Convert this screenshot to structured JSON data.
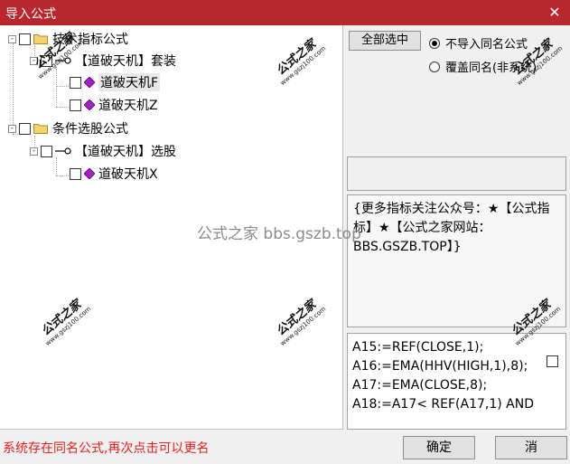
{
  "window": {
    "title": "导入公式",
    "close_glyph": "✕"
  },
  "tree": {
    "groups": [
      {
        "label": "技术指标公式",
        "expander": "-",
        "children": [
          {
            "label": "【道破天机】套装",
            "expander": "-",
            "items": [
              {
                "label": "道破天机F"
              },
              {
                "label": "道破天机Z"
              }
            ]
          }
        ]
      },
      {
        "label": "条件选股公式",
        "expander": "-",
        "children": [
          {
            "label": "【道破天机】选股",
            "expander": "-",
            "items": [
              {
                "label": "道破天机X"
              }
            ]
          }
        ]
      }
    ]
  },
  "options": {
    "select_all_label": "全部选中",
    "radio_no_import": "不导入同名公式",
    "radio_overwrite": "覆盖同名(非系统)"
  },
  "description": "{更多指标关注公众号：★【公式指标】★【公式之家网站：BBS.GSZB.TOP】}",
  "code_lines": [
    "A15:=REF(CLOSE,1);",
    "A16:=EMA(HHV(HIGH,1),8);",
    "A17:=EMA(CLOSE,8);",
    "A18:=A17< REF(A17,1) AND"
  ],
  "status": "系统存在同名公式,再次点击可以更名",
  "buttons": {
    "ok": "确定",
    "cancel": "消"
  },
  "watermark": {
    "site": "公式之家",
    "url": "www.gszj100.com",
    "center": "公式之家 bbs.gszb.top"
  },
  "colors": {
    "title_bar": "#b8272d",
    "status_text": "#e02020",
    "folder": "#f3d36b",
    "gem": "#a020c0"
  }
}
